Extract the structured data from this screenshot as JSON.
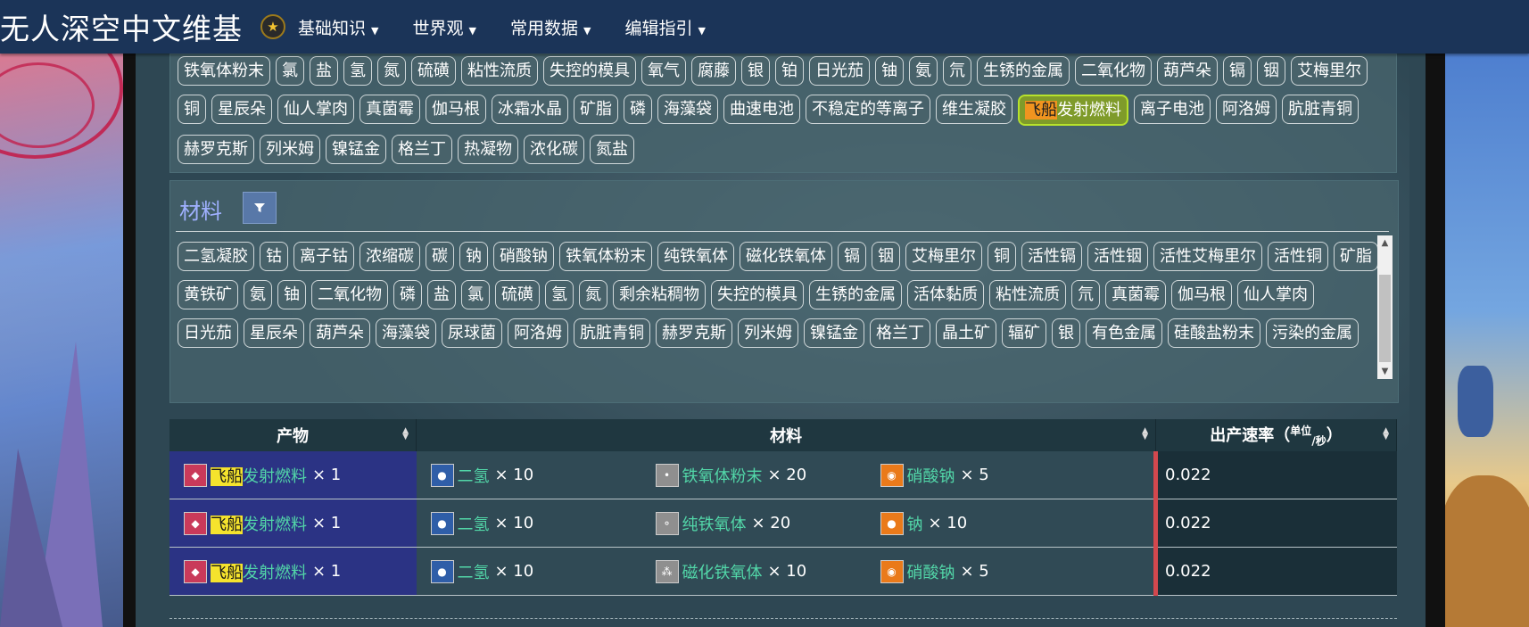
{
  "site": {
    "title": "无人深空中文维基",
    "nav": [
      {
        "label": "基础知识"
      },
      {
        "label": "世界观"
      },
      {
        "label": "常用数据"
      },
      {
        "label": "编辑指引"
      }
    ]
  },
  "product_tags": [
    "铁氧体粉末",
    "氯",
    "盐",
    "氢",
    "氮",
    "硫磺",
    "粘性流质",
    "失控的模具",
    "氧气",
    "腐藤",
    "银",
    "铂",
    "日光茄",
    "铀",
    "氨",
    "氘",
    "生锈的金属",
    "二氧化物",
    "葫芦朵",
    "镉",
    "铟",
    "艾梅里尔",
    "铜",
    "星辰朵",
    "仙人掌肉",
    "真菌霉",
    "伽马根",
    "冰霜水晶",
    "矿脂",
    "磷",
    "海藻袋",
    "曲速电池",
    "不稳定的等离子",
    "维生凝胶",
    "飞船发射燃料",
    "离子电池",
    "阿洛姆",
    "肮脏青铜",
    "赫罗克斯",
    "列米姆",
    "镍锰金",
    "格兰丁",
    "热凝物",
    "浓化碳",
    "氮盐"
  ],
  "highlighted_tag": {
    "prefix": "飞船",
    "suffix": "发射燃料"
  },
  "materials_section": {
    "title": "材料",
    "filter_icon": "filter-icon",
    "tags": [
      "二氢凝胶",
      "钴",
      "离子钴",
      "浓缩碳",
      "碳",
      "钠",
      "硝酸钠",
      "铁氧体粉末",
      "纯铁氧体",
      "磁化铁氧体",
      "镉",
      "铟",
      "艾梅里尔",
      "铜",
      "活性镉",
      "活性铟",
      "活性艾梅里尔",
      "活性铜",
      "矿脂",
      "黄铁矿",
      "氨",
      "铀",
      "二氧化物",
      "磷",
      "盐",
      "氯",
      "硫磺",
      "氢",
      "氮",
      "剩余粘稠物",
      "失控的模具",
      "生锈的金属",
      "活体黏质",
      "粘性流质",
      "氘",
      "真菌霉",
      "伽马根",
      "仙人掌肉",
      "日光茄",
      "星辰朵",
      "葫芦朵",
      "海藻袋",
      "尿球菌",
      "阿洛姆",
      "肮脏青铜",
      "赫罗克斯",
      "列米姆",
      "镍锰金",
      "格兰丁",
      "晶土矿",
      "辐矿",
      "银",
      "有色金属",
      "硅酸盐粉末",
      "污染的金属"
    ]
  },
  "table": {
    "headers": {
      "product": "产物",
      "materials": "材料",
      "rate": "出产速率（",
      "rate_unit_a": "单位",
      "rate_unit_b": "/秒",
      "rate_close": "）"
    },
    "rows": [
      {
        "product": {
          "hl": "飞船",
          "rest": "发射燃料",
          "qty": "× 1",
          "icon": "fuel-canister-icon"
        },
        "materials": [
          {
            "name": "二氢",
            "qty": "× 10",
            "icon": "di-hydrogen-icon"
          },
          {
            "name": "铁氧体粉末",
            "qty": "× 20",
            "icon": "ferrite-dust-icon"
          },
          {
            "name": "硝酸钠",
            "qty": "× 5",
            "icon": "sodium-nitrate-icon"
          }
        ],
        "rate": "0.022"
      },
      {
        "product": {
          "hl": "飞船",
          "rest": "发射燃料",
          "qty": "× 1",
          "icon": "fuel-canister-icon"
        },
        "materials": [
          {
            "name": "二氢",
            "qty": "× 10",
            "icon": "di-hydrogen-icon"
          },
          {
            "name": "纯铁氧体",
            "qty": "× 20",
            "icon": "pure-ferrite-icon"
          },
          {
            "name": "钠",
            "qty": "× 10",
            "icon": "sodium-icon"
          }
        ],
        "rate": "0.022"
      },
      {
        "product": {
          "hl": "飞船",
          "rest": "发射燃料",
          "qty": "× 1",
          "icon": "fuel-canister-icon"
        },
        "materials": [
          {
            "name": "二氢",
            "qty": "× 10",
            "icon": "di-hydrogen-icon"
          },
          {
            "name": "磁化铁氧体",
            "qty": "× 10",
            "icon": "magnetised-ferrite-icon"
          },
          {
            "name": "硝酸钠",
            "qty": "× 5",
            "icon": "sodium-nitrate-icon"
          }
        ],
        "rate": "0.022"
      }
    ]
  }
}
